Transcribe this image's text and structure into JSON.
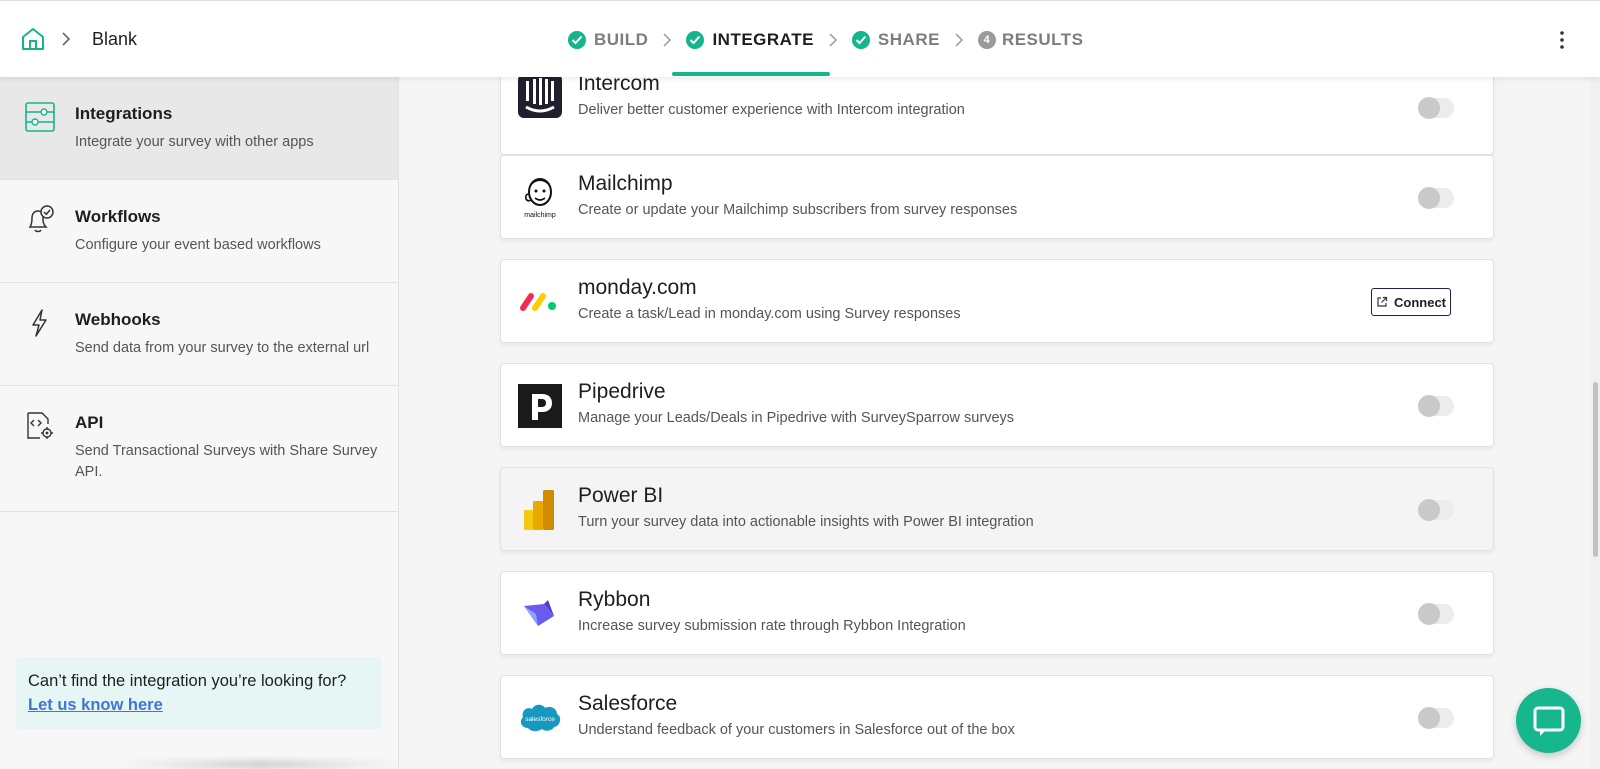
{
  "header": {
    "breadcrumb_title": "Blank",
    "steps": [
      {
        "label": "BUILD",
        "state": "done"
      },
      {
        "label": "INTEGRATE",
        "state": "active"
      },
      {
        "label": "SHARE",
        "state": "done"
      },
      {
        "label": "RESULTS",
        "state": "pending",
        "number": "4"
      }
    ]
  },
  "sidebar": {
    "items": [
      {
        "title": "Integrations",
        "desc": "Integrate your survey with other apps",
        "icon": "sliders-icon"
      },
      {
        "title": "Workflows",
        "desc": "Configure your event based workflows",
        "icon": "bell-check-icon"
      },
      {
        "title": "Webhooks",
        "desc": "Send data from your survey to the external url",
        "icon": "lightning-icon"
      },
      {
        "title": "API",
        "desc": "Send Transactional Surveys with Share Survey API.",
        "icon": "code-gear-icon"
      }
    ],
    "help": {
      "text": "Can’t find the integration you’re looking for?",
      "link": "Let us know here"
    }
  },
  "integrations": [
    {
      "name": "Intercom",
      "desc": "Deliver better customer experience with Intercom integration",
      "logo": "intercom-logo",
      "action": "toggle"
    },
    {
      "name": "Mailchimp",
      "desc": "Create or update your Mailchimp subscribers from survey responses",
      "logo": "mailchimp-logo",
      "logo_text": "mailchimp",
      "action": "toggle"
    },
    {
      "name": "monday.com",
      "desc": "Create a task/Lead in monday.com using Survey responses",
      "logo": "monday-logo",
      "action": "connect",
      "action_label": "Connect"
    },
    {
      "name": "Pipedrive",
      "desc": "Manage your Leads/Deals in Pipedrive with SurveySparrow surveys",
      "logo": "pipedrive-logo",
      "action": "toggle"
    },
    {
      "name": "Power BI",
      "desc": "Turn your survey data into actionable insights with Power BI integration",
      "logo": "powerbi-logo",
      "action": "toggle"
    },
    {
      "name": "Rybbon",
      "desc": "Increase survey submission rate through Rybbon Integration",
      "logo": "rybbon-logo",
      "action": "toggle"
    },
    {
      "name": "Salesforce",
      "desc": "Understand feedback of your customers in Salesforce out of the box",
      "logo": "salesforce-logo",
      "logo_text": "salesforce",
      "action": "toggle"
    }
  ],
  "colors": {
    "accent": "#14b58a",
    "link": "#3f75d9",
    "help_bg": "#e6f6f5",
    "chat": "#16b78c"
  }
}
